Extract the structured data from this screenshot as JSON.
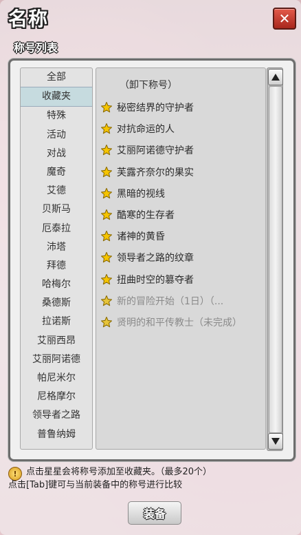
{
  "window": {
    "title": "名称",
    "subtitle": "称号列表",
    "close_label": "✕"
  },
  "categories": [
    {
      "label": "全部"
    },
    {
      "label": "收藏夹",
      "selected": true
    },
    {
      "label": "特殊"
    },
    {
      "label": "活动"
    },
    {
      "label": "对战"
    },
    {
      "label": "魔奇"
    },
    {
      "label": "艾德"
    },
    {
      "label": "贝斯马"
    },
    {
      "label": "厄泰拉"
    },
    {
      "label": "沛塔"
    },
    {
      "label": "拜德"
    },
    {
      "label": "哈梅尔"
    },
    {
      "label": "桑德斯"
    },
    {
      "label": "拉诺斯"
    },
    {
      "label": "艾丽西昂"
    },
    {
      "label": "艾丽阿诺德"
    },
    {
      "label": "帕尼米尔"
    },
    {
      "label": "尼格摩尔"
    },
    {
      "label": "领导者之路"
    },
    {
      "label": "普鲁纳姆"
    }
  ],
  "titles": {
    "unequip_label": "（卸下称号）",
    "items": [
      {
        "label": "秘密结界的守护者",
        "starred": true,
        "dim": false
      },
      {
        "label": "对抗命运的人",
        "starred": true,
        "dim": false
      },
      {
        "label": "艾丽阿诺德守护者",
        "starred": true,
        "dim": false
      },
      {
        "label": "芙露齐奈尔的果实",
        "starred": true,
        "dim": false
      },
      {
        "label": "黑暗的视线",
        "starred": true,
        "dim": false
      },
      {
        "label": "酷寒的生存者",
        "starred": true,
        "dim": false
      },
      {
        "label": "诸神的黄昏",
        "starred": true,
        "dim": false
      },
      {
        "label": "领导者之路的纹章",
        "starred": true,
        "dim": false
      },
      {
        "label": "扭曲时空的篡夺者",
        "starred": true,
        "dim": false
      },
      {
        "label": "新的冒险开始（1日）（...",
        "starred": true,
        "dim": true
      },
      {
        "label": "贤明的和平传教士（未完成）",
        "starred": true,
        "dim": true
      }
    ]
  },
  "hint": {
    "icon": "info-icon",
    "icon_glyph": "!",
    "line1": "点击星星会将称号添加至收藏夹。（最多20个）",
    "line2": "点击[Tab]键可与当前装备中的称号进行比较"
  },
  "equip_button": {
    "label": "装备"
  },
  "colors": {
    "star_fill": "#f5c400",
    "star_stroke": "#8a6a00",
    "selected_category_bg": "#c6dbdf",
    "close_button": "#c43a2d"
  }
}
